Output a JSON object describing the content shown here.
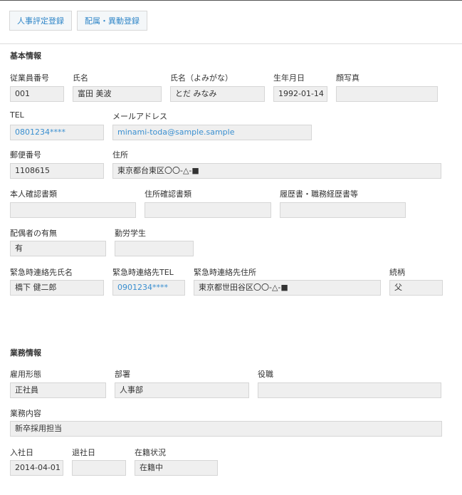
{
  "tabs": [
    {
      "label": "人事評定登録"
    },
    {
      "label": "配属・異動登録"
    }
  ],
  "basic": {
    "title": "基本情報",
    "employee_no": {
      "label": "従業員番号",
      "value": "001"
    },
    "name": {
      "label": "氏名",
      "value": "富田 美波"
    },
    "name_kana": {
      "label": "氏名（よみがな）",
      "value": "とだ みなみ"
    },
    "birthdate": {
      "label": "生年月日",
      "value": "1992-01-14"
    },
    "photo": {
      "label": "顔写真",
      "value": ""
    },
    "tel": {
      "label": "TEL",
      "value": "0801234****"
    },
    "email": {
      "label": "メールアドレス",
      "value": "minami-toda@sample.sample"
    },
    "postal": {
      "label": "郵便番号",
      "value": "1108615"
    },
    "address": {
      "label": "住所",
      "value": "東京都台東区〇〇-△-■"
    },
    "id_doc": {
      "label": "本人確認書類",
      "value": ""
    },
    "address_doc": {
      "label": "住所確認書類",
      "value": ""
    },
    "resume": {
      "label": "履歴書・職務経歴書等",
      "value": ""
    },
    "spouse": {
      "label": "配偶者の有無",
      "value": "有"
    },
    "student": {
      "label": "勤労学生",
      "value": ""
    },
    "emergency_name": {
      "label": "緊急時連絡先氏名",
      "value": "橋下 健二郎"
    },
    "emergency_tel": {
      "label": "緊急時連絡先TEL",
      "value": "0901234****"
    },
    "emergency_address": {
      "label": "緊急時連絡先住所",
      "value": "東京都世田谷区〇〇-△-■"
    },
    "relation": {
      "label": "続柄",
      "value": "父"
    }
  },
  "work": {
    "title": "業務情報",
    "employment_type": {
      "label": "雇用形態",
      "value": "正社員"
    },
    "department": {
      "label": "部署",
      "value": "人事部"
    },
    "position": {
      "label": "役職",
      "value": ""
    },
    "duties": {
      "label": "業務内容",
      "value": "新卒採用担当"
    },
    "join_date": {
      "label": "入社日",
      "value": "2014-04-01"
    },
    "leave_date": {
      "label": "退社日",
      "value": ""
    },
    "status": {
      "label": "在籍状況",
      "value": "在籍中"
    }
  }
}
